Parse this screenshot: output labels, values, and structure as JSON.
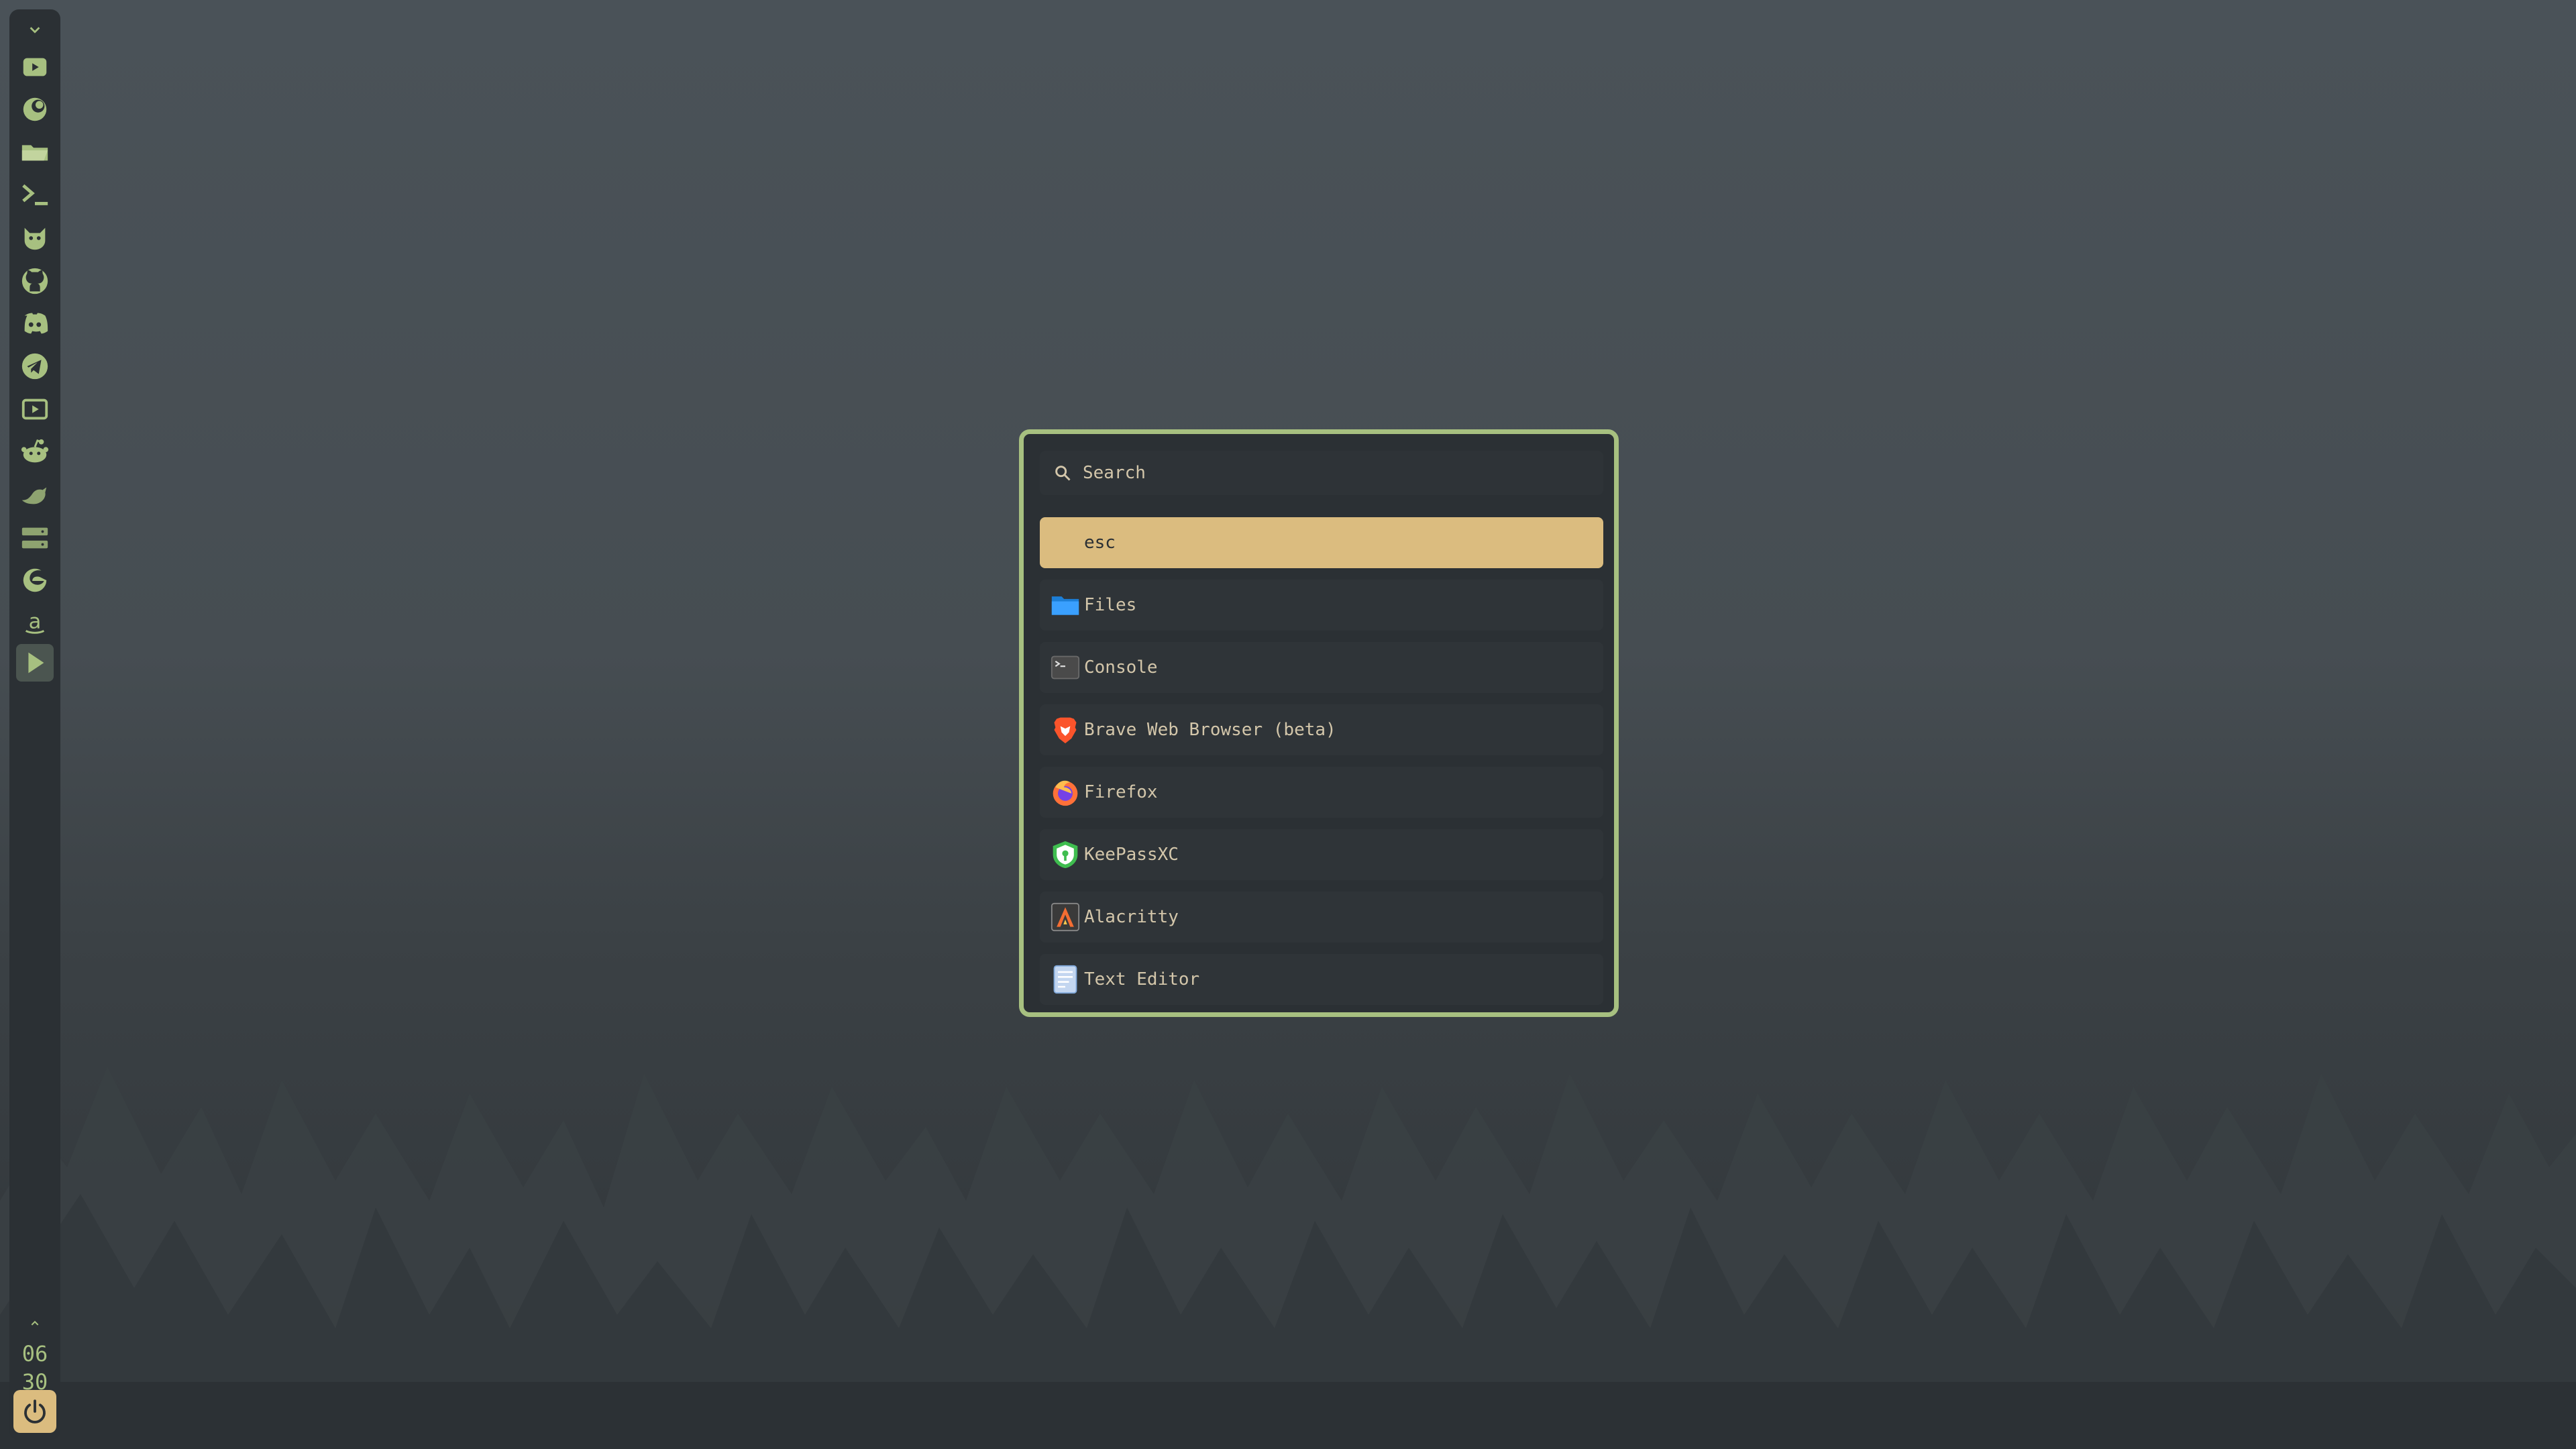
{
  "sidebar": {
    "items": [
      {
        "name": "media-player-icon"
      },
      {
        "name": "moon-icon"
      },
      {
        "name": "folder-icon"
      },
      {
        "name": "terminal-icon"
      },
      {
        "name": "cat-icon"
      },
      {
        "name": "github-icon"
      },
      {
        "name": "discord-icon"
      },
      {
        "name": "telegram-icon"
      },
      {
        "name": "youtube-icon"
      },
      {
        "name": "reddit-icon"
      },
      {
        "name": "bird-icon"
      },
      {
        "name": "server-icon"
      },
      {
        "name": "edge-icon"
      },
      {
        "name": "amazon-icon"
      },
      {
        "name": "play-button-icon"
      }
    ],
    "clock": {
      "hour": "06",
      "minute": "30"
    },
    "accent": "#a7c080",
    "power_color": "#dbbc7f"
  },
  "launcher": {
    "search": {
      "placeholder": "Search",
      "value": ""
    },
    "border_color": "#a7c080",
    "selected_color": "#dbbc7f",
    "entries": [
      {
        "label": "esc",
        "icon": "none",
        "selected": true
      },
      {
        "label": "Files",
        "icon": "folder-icon"
      },
      {
        "label": "Console",
        "icon": "console-icon"
      },
      {
        "label": "Brave Web Browser (beta)",
        "icon": "brave-icon"
      },
      {
        "label": "Firefox",
        "icon": "firefox-icon"
      },
      {
        "label": "KeePassXC",
        "icon": "keepassxc-icon"
      },
      {
        "label": "Alacritty",
        "icon": "alacritty-icon"
      },
      {
        "label": "Text Editor",
        "icon": "text-editor-icon"
      }
    ]
  }
}
